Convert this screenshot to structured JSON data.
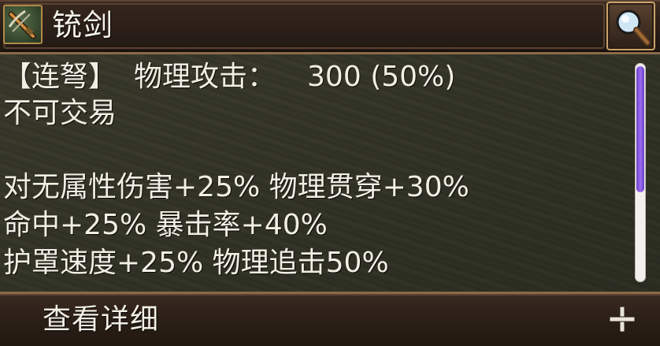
{
  "header": {
    "title": "铳剑",
    "item_icon": "crossbow-item-icon",
    "search_icon": "magnifier-icon"
  },
  "stats": {
    "line1_type": "【连弩】",
    "line1_stat": "物理攻击：",
    "line1_value": "300 (50%)",
    "line2": "不可交易",
    "line3a": "对无属性伤害+25%",
    "line3b": "物理贯穿+30%",
    "line4a": "命中+25%",
    "line4b": "暴击率+40%",
    "line5a": "护罩速度+25%",
    "line5b": "物理追击50%"
  },
  "footer": {
    "detail_label": "查看详细",
    "expand_icon": "plus-icon"
  },
  "colors": {
    "header_bg": "#2a1e17",
    "border": "#8a6a4a",
    "scroll_thumb": "#7a4ad8",
    "text": "#f1eee4"
  }
}
